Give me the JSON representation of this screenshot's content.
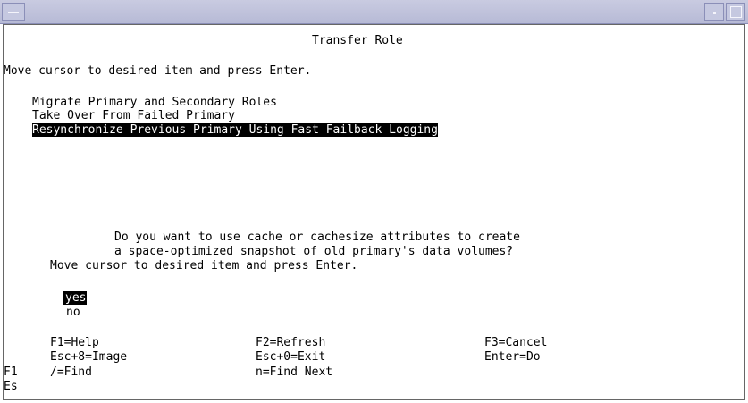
{
  "window": {
    "menu_icon": "window-menu-icon",
    "minimize_icon": "minimize-icon",
    "maximize_icon": "maximize-icon"
  },
  "screen": {
    "title": "Transfer Role",
    "instruction": "Move cursor to desired item and press Enter.",
    "menu_items": [
      "Migrate Primary and Secondary Roles",
      "Take Over From Failed Primary",
      "Resynchronize Previous Primary Using Fast Failback Logging"
    ]
  },
  "dialog": {
    "question_line1": "Do you want to use cache or cachesize attributes to create",
    "question_line2": "a space-optimized snapshot of old primary's data volumes?",
    "instruction": "Move cursor to desired item and press Enter.",
    "options": [
      "yes",
      "no"
    ]
  },
  "function_keys": [
    [
      "F1=Help",
      "F2=Refresh",
      "F3=Cancel"
    ],
    [
      "Esc+8=Image",
      "Esc+0=Exit",
      "Enter=Do"
    ],
    [
      "/=Find",
      "n=Find Next"
    ]
  ],
  "background_keys": [
    "F1",
    "Es"
  ]
}
